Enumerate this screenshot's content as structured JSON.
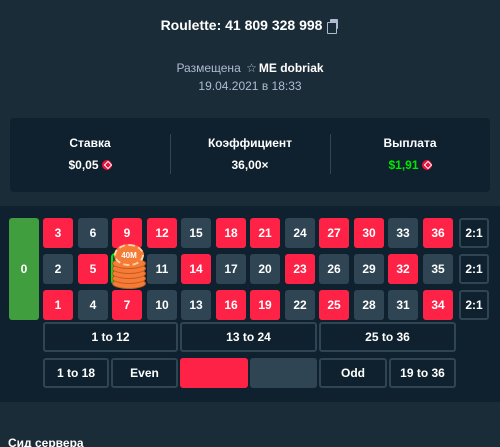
{
  "header": {
    "title": "Roulette: 41 809 328 998",
    "copy_icon": "copy-icon",
    "placed_prefix": "Размещена",
    "star_icon": "star-icon",
    "username": "ME dobriak",
    "date": "19.04.2021 в 18:33"
  },
  "stats": {
    "bet_label": "Ставка",
    "bet_value": "$0,05",
    "multiplier_label": "Коэффициент",
    "multiplier_value": "36,00×",
    "payout_label": "Выплата",
    "payout_value": "$1,91",
    "currency_icon": "gem-icon",
    "colors": {
      "payout": "#00e701",
      "currency": "#e9113c"
    }
  },
  "board": {
    "zero": "0",
    "rows": [
      [
        {
          "n": "3",
          "c": "red"
        },
        {
          "n": "6",
          "c": "black"
        },
        {
          "n": "9",
          "c": "red"
        },
        {
          "n": "12",
          "c": "red"
        },
        {
          "n": "15",
          "c": "black"
        },
        {
          "n": "18",
          "c": "red"
        },
        {
          "n": "21",
          "c": "red"
        },
        {
          "n": "24",
          "c": "black"
        },
        {
          "n": "27",
          "c": "red"
        },
        {
          "n": "30",
          "c": "red"
        },
        {
          "n": "33",
          "c": "black"
        },
        {
          "n": "36",
          "c": "red"
        }
      ],
      [
        {
          "n": "2",
          "c": "black"
        },
        {
          "n": "5",
          "c": "red"
        },
        {
          "n": "8",
          "c": "black"
        },
        {
          "n": "11",
          "c": "black"
        },
        {
          "n": "14",
          "c": "red"
        },
        {
          "n": "17",
          "c": "black"
        },
        {
          "n": "20",
          "c": "black"
        },
        {
          "n": "23",
          "c": "red"
        },
        {
          "n": "26",
          "c": "black"
        },
        {
          "n": "29",
          "c": "black"
        },
        {
          "n": "32",
          "c": "red"
        },
        {
          "n": "35",
          "c": "black"
        }
      ],
      [
        {
          "n": "1",
          "c": "red"
        },
        {
          "n": "4",
          "c": "black"
        },
        {
          "n": "7",
          "c": "red"
        },
        {
          "n": "10",
          "c": "black"
        },
        {
          "n": "13",
          "c": "black"
        },
        {
          "n": "16",
          "c": "red"
        },
        {
          "n": "19",
          "c": "red"
        },
        {
          "n": "22",
          "c": "black"
        },
        {
          "n": "25",
          "c": "red"
        },
        {
          "n": "28",
          "c": "black"
        },
        {
          "n": "31",
          "c": "black"
        },
        {
          "n": "34",
          "c": "red"
        }
      ]
    ],
    "column_bets": [
      "2:1",
      "2:1",
      "2:1"
    ],
    "dozens": [
      "1 to 12",
      "13 to 24",
      "25 to 36"
    ],
    "outside": {
      "low": "1 to 18",
      "even": "Even",
      "odd": "Odd",
      "high": "19 to 36"
    },
    "chip_label": "40M",
    "selected_number": "8",
    "colors": {
      "red": "#fe2247",
      "black": "#2f4553",
      "green": "#419e3f",
      "chip": "#f57c36"
    }
  },
  "footer": {
    "section_label": "Сид сервера"
  }
}
